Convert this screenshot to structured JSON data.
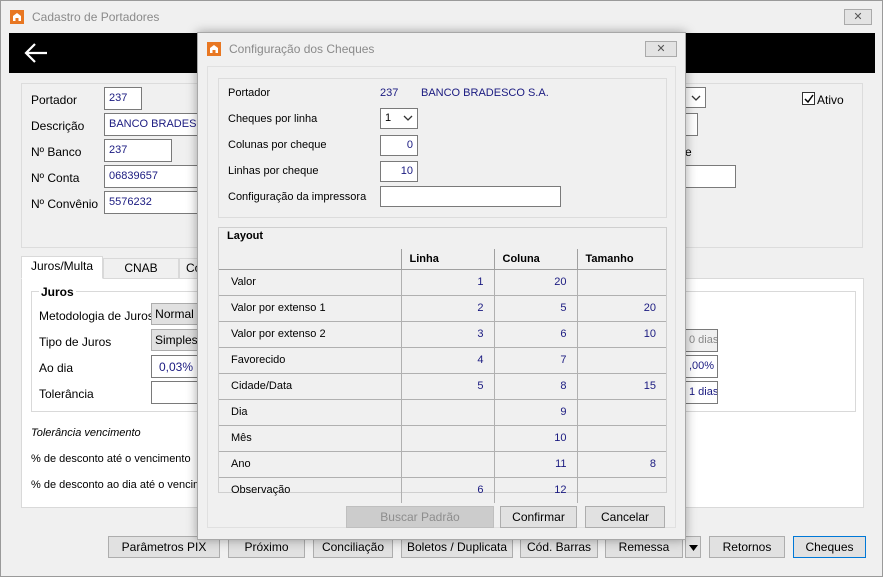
{
  "main": {
    "title": "Cadastro de Portadores",
    "close": "✕",
    "fields": {
      "portador_label": "Portador",
      "portador_value": "237",
      "descricao_label": "Descrição",
      "descricao_value": "BANCO BRADESCO",
      "nbanco_label": "Nº Banco",
      "nbanco_value": "237",
      "nconta_label": "Nº Conta",
      "nconta_value": "06839657",
      "nconvenio_label": "Nº Convênio",
      "nconvenio_value": "5576232",
      "ativo_label": "Ativo",
      "partial_e": "e"
    },
    "tabs": [
      "Juros/Multa",
      "CNAB",
      "Co"
    ],
    "juros": {
      "group_label": "Juros",
      "metodologia_label": "Metodologia de Juros",
      "metodologia_value": "Normal",
      "tipo_label": "Tipo de Juros",
      "tipo_value": "Simples",
      "aodia_label": "Ao dia",
      "aodia_value": "0,03%",
      "tolerancia_label": "Tolerância",
      "right_1": "0 dias",
      "right_2": ",00%",
      "right_3": "1 dias"
    },
    "tolerancia_vencimento": "Tolerância vencimento",
    "desconto_ate": "% de desconto até o vencimento",
    "desconto_aodia": "% de desconto ao dia até o vencim",
    "bottom_buttons": [
      "Parâmetros PIX",
      "Próximo",
      "Conciliação",
      "Boletos / Duplicata",
      "Cód. Barras",
      "Remessa",
      "Retornos",
      "Cheques"
    ]
  },
  "dialog": {
    "title": "Configuração dos Cheques",
    "close": "✕",
    "portador_label": "Portador",
    "portador_code": "237",
    "portador_name": "BANCO BRADESCO S.A.",
    "cheques_por_linha_label": "Cheques por linha",
    "cheques_por_linha_value": "1",
    "colunas_label": "Colunas por cheque",
    "colunas_value": "0",
    "linhas_label": "Linhas por cheque",
    "linhas_value": "10",
    "impressora_label": "Configuração da impressora",
    "impressora_value": "",
    "layout": {
      "title": "Layout",
      "headers": [
        "Linha",
        "Coluna",
        "Tamanho"
      ],
      "rows": [
        {
          "label": "Valor",
          "linha": "1",
          "coluna": "20",
          "tamanho": ""
        },
        {
          "label": "Valor por extenso 1",
          "linha": "2",
          "coluna": "5",
          "tamanho": "20"
        },
        {
          "label": "Valor por extenso 2",
          "linha": "3",
          "coluna": "6",
          "tamanho": "10"
        },
        {
          "label": "Favorecido",
          "linha": "4",
          "coluna": "7",
          "tamanho": ""
        },
        {
          "label": "Cidade/Data",
          "linha": "5",
          "coluna": "8",
          "tamanho": "15"
        },
        {
          "label": "Dia",
          "linha": "",
          "coluna": "9",
          "tamanho": ""
        },
        {
          "label": "Mês",
          "linha": "",
          "coluna": "10",
          "tamanho": ""
        },
        {
          "label": "Ano",
          "linha": "",
          "coluna": "11",
          "tamanho": "8"
        },
        {
          "label": "Observação",
          "linha": "6",
          "coluna": "12",
          "tamanho": ""
        }
      ]
    },
    "buttons": {
      "buscar": "Buscar Padrão",
      "confirmar": "Confirmar",
      "cancelar": "Cancelar"
    }
  }
}
